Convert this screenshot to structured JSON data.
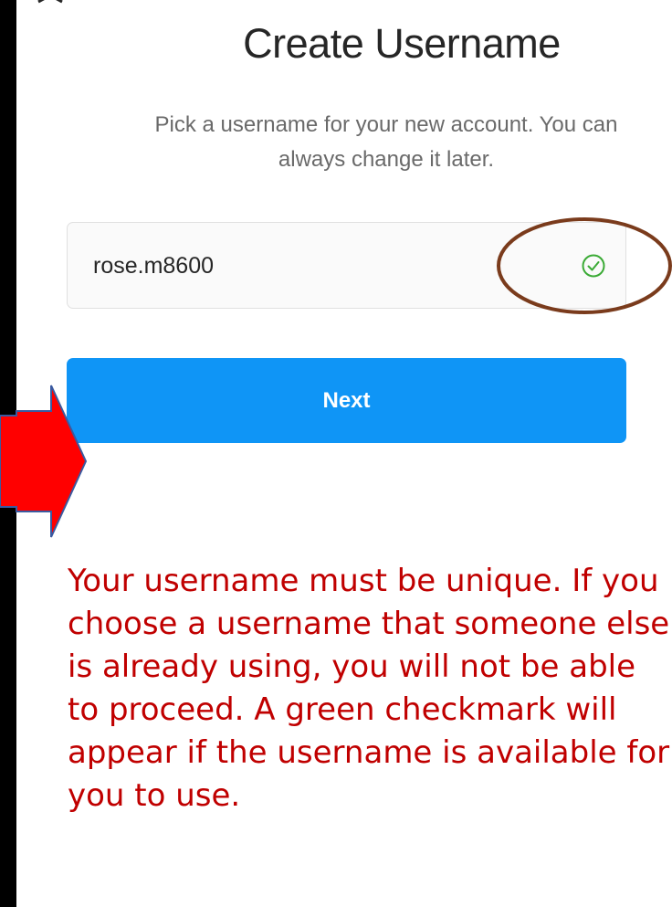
{
  "screen": {
    "title": "Create Username",
    "subtitle": "Pick a username for your new account. You can always change it later.",
    "username_value": "rose.m8600",
    "next_label": "Next",
    "username_status": "available"
  },
  "annotation": {
    "instructions": "Your username must be unique. If you choose a username that someone else is already using, you will not be able to proceed. A green checkmark will appear if the username is available for you to use."
  },
  "icons": {
    "close": "close-icon",
    "check": "check-circle-icon",
    "arrow": "red-arrow-icon"
  },
  "colors": {
    "accent": "#0f95f6",
    "check": "#3aaa35",
    "annotation_text": "#c00000",
    "highlight_oval": "#7a3b1c",
    "arrow_fill": "#ff0000",
    "arrow_stroke": "#3a5aa0"
  }
}
